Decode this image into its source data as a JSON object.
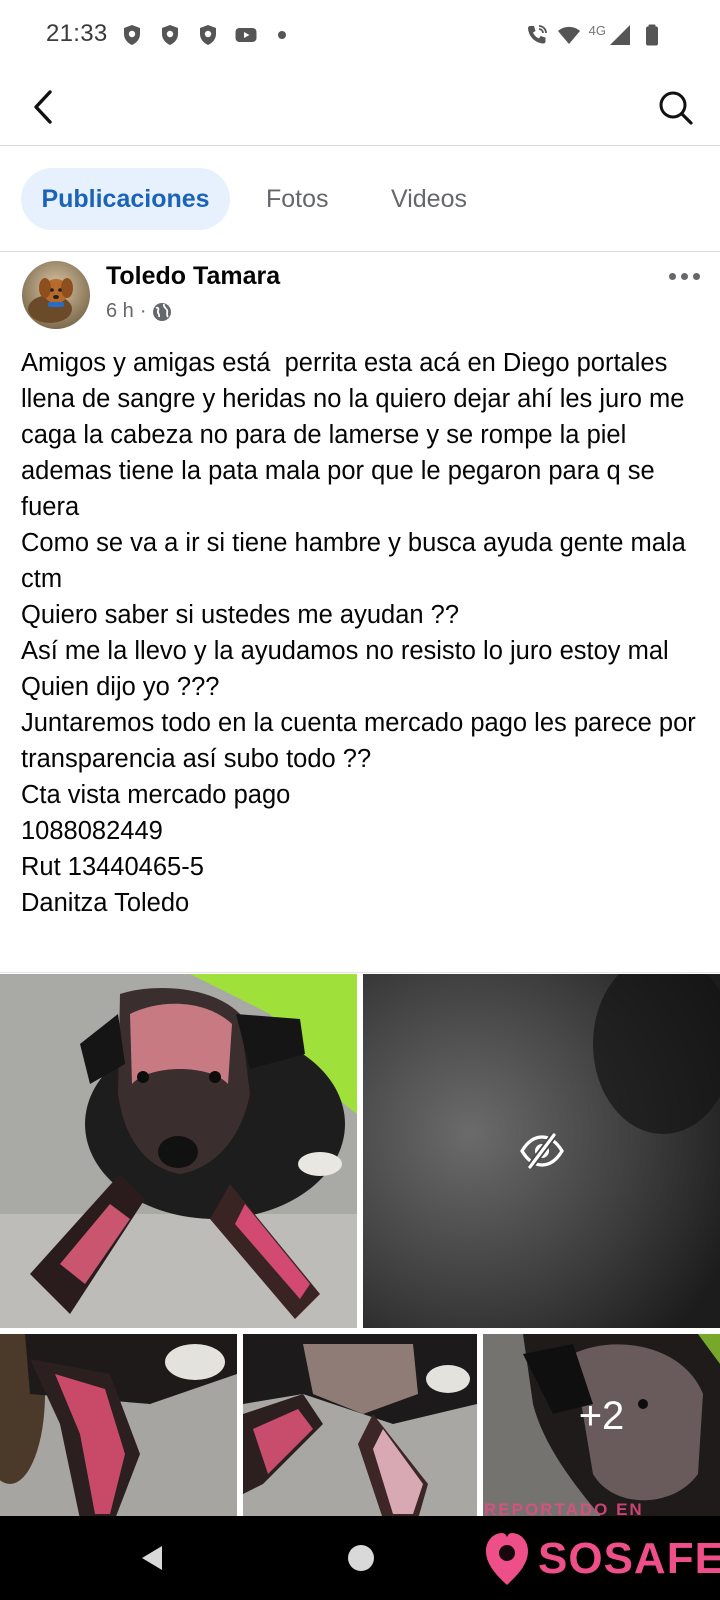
{
  "status_bar": {
    "time": "21:33",
    "left_icons": [
      "shield-icon",
      "shield-icon",
      "shield-icon",
      "youtube-icon",
      "dot-icon"
    ],
    "right_icons": [
      "wifi-call-icon",
      "wifi-icon",
      "signal-icon",
      "battery-icon"
    ],
    "network_label": "4G"
  },
  "app_bar": {
    "back_icon": "back-arrow-icon",
    "search_icon": "search-icon"
  },
  "tabs": [
    {
      "label": "Publicaciones",
      "active": true
    },
    {
      "label": "Fotos",
      "active": false
    },
    {
      "label": "Videos",
      "active": false
    }
  ],
  "post": {
    "author": "Toledo Tamara",
    "time": "6 h",
    "separator": "·",
    "privacy_icon": "globe-icon",
    "lines": [
      "Amigos y amigas está  perrita esta acá en Diego portales llena de sangre y heridas no la quiero dejar ahí les juro me caga la cabeza no para de lamerse y se rompe la piel ademas tiene la pata mala por que le pegaron para q se fuera",
      "Como se va a ir si tiene hambre y busca ayuda gente mala ctm",
      "Quiero saber si ustedes me ayudan ??",
      "Así me la llevo y la ayudamos no resisto lo juro estoy mal",
      "Quien dijo yo ???",
      "Juntaremos todo en la cuenta mercado pago les parece por transparencia así subo todo ??",
      "Cta vista mercado pago",
      "1088082449",
      "Rut 13440465-5",
      "Danitza Toledo"
    ],
    "media": {
      "photo_count": 5,
      "hidden_photo_icon": "eye-off-icon",
      "more_count": "+2"
    }
  },
  "nav_bar": {
    "back_icon": "nav-back-icon",
    "home_icon": "nav-home-icon"
  },
  "watermark": {
    "top": "REPORTADO EN",
    "brand": "SOSAFE",
    "color": "#ee4f89"
  },
  "colors": {
    "accent": "#1a63b8",
    "tab_active_bg": "#e7f1fd",
    "secondary_text": "#65676b"
  }
}
